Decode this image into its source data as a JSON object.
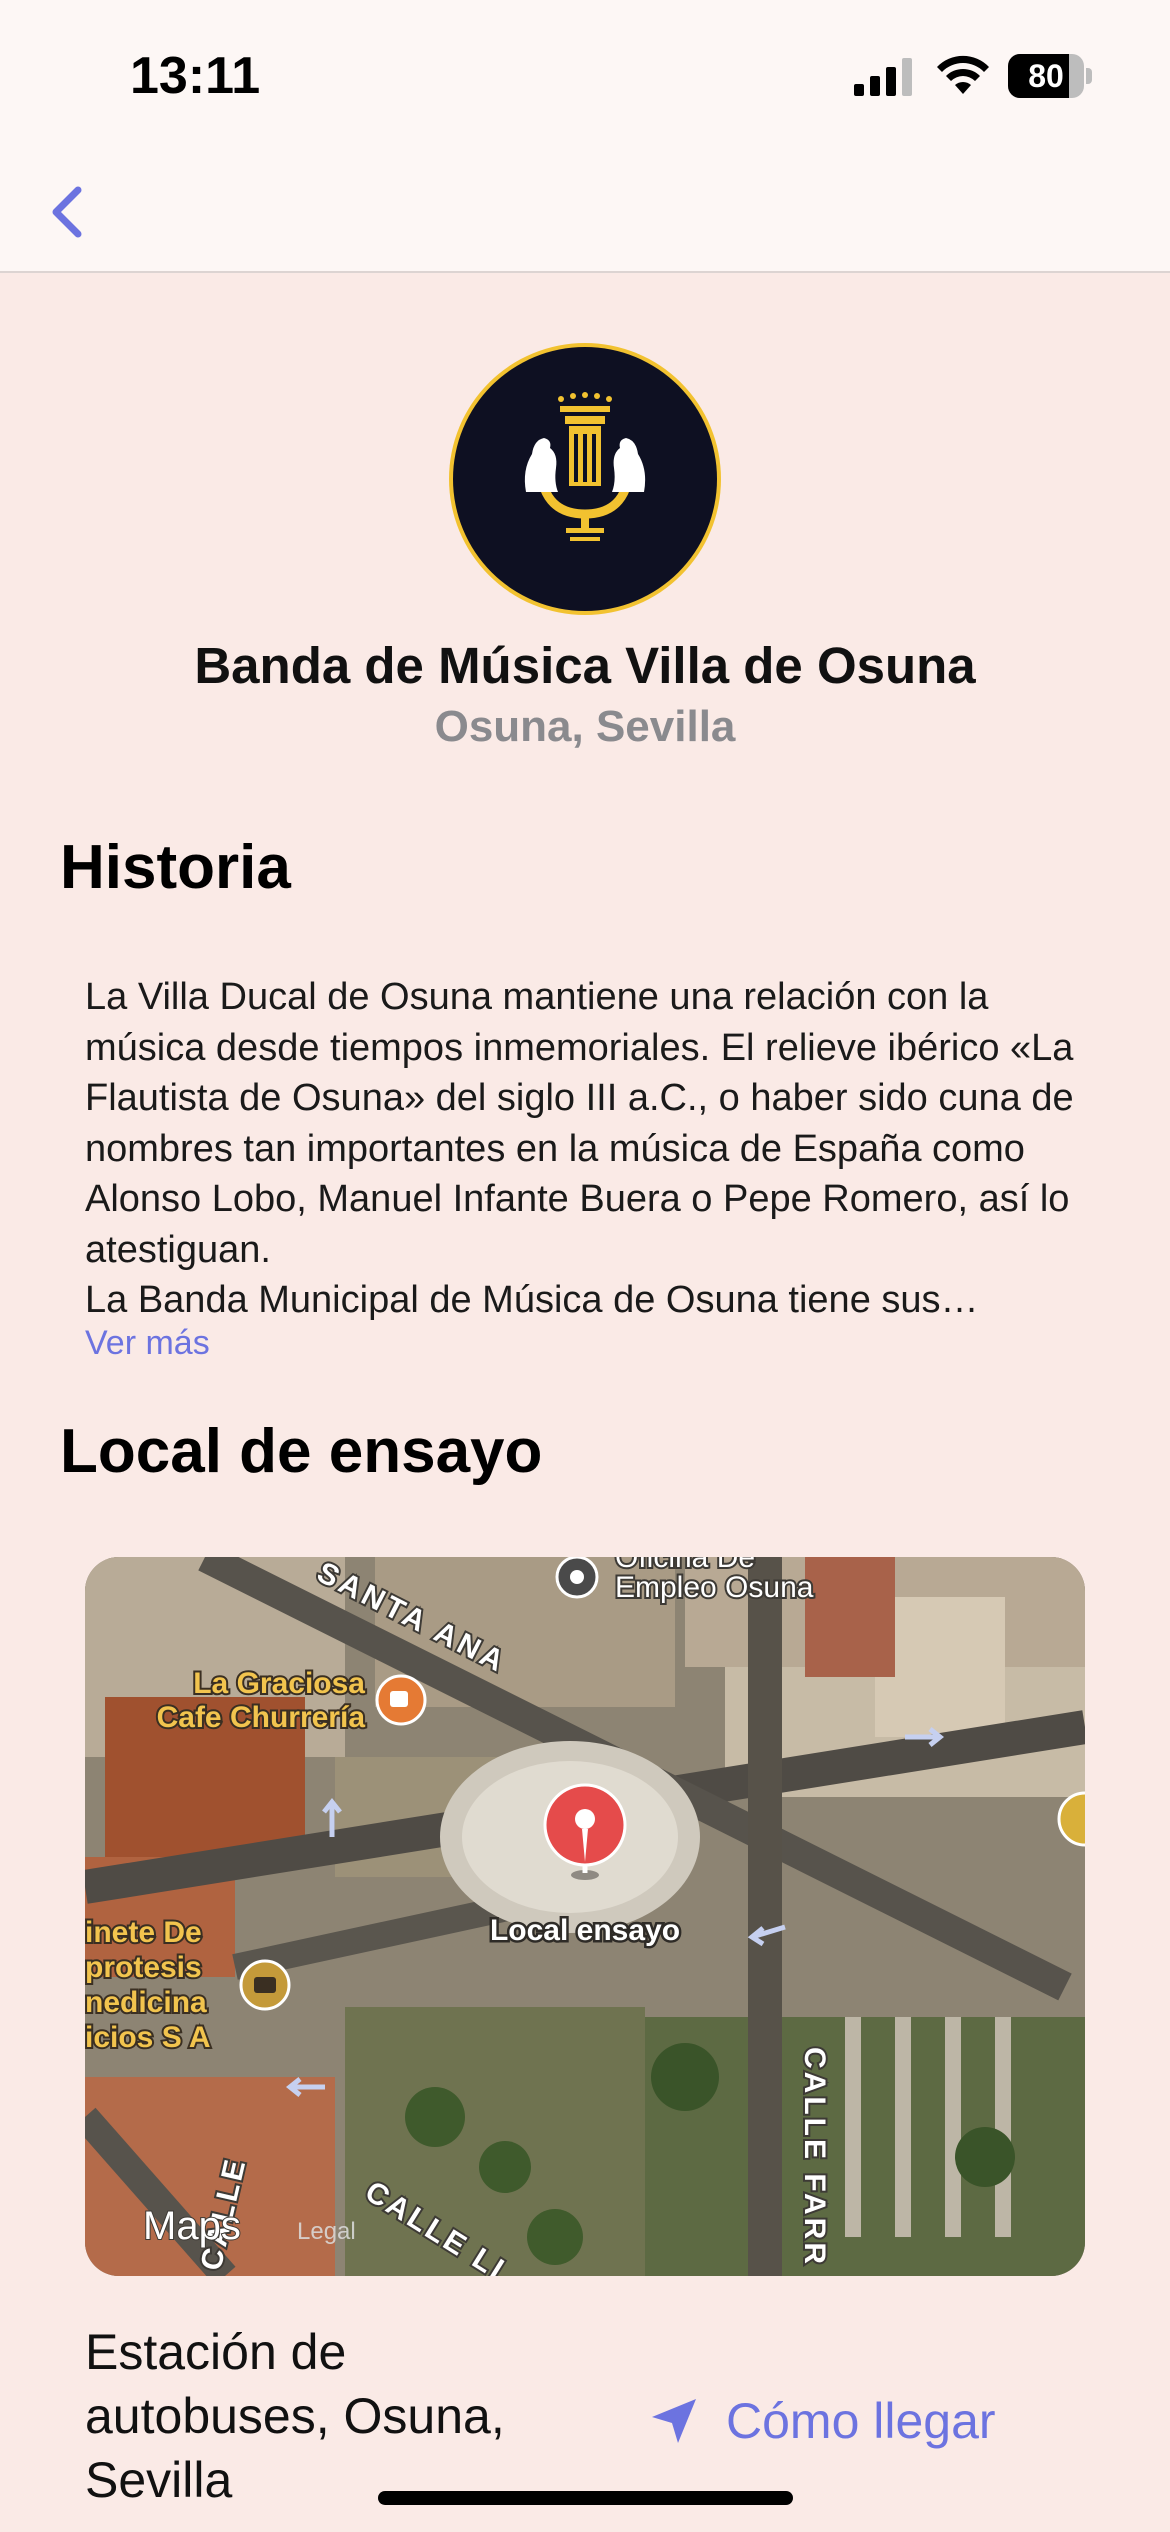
{
  "status_bar": {
    "time": "13:11",
    "battery_level": "80"
  },
  "band": {
    "name": "Banda de Música Villa de Osuna",
    "location": "Osuna, Sevilla"
  },
  "history": {
    "heading": "Historia",
    "text": "La Villa Ducal de Osuna mantiene una relación con la música desde tiempos inmemoriales. El relieve ibérico «La Flautista de Osuna» del siglo III a.C., o haber sido cuna de nombres tan importantes en la música de España como Alonso Lobo, Manuel Infante Buera o Pepe Romero, así lo atestiguan.\nLa Banda Municipal de Música de Osuna tiene sus orígenes…",
    "see_more": "Ver más"
  },
  "rehearsal": {
    "heading": "Local de ensayo",
    "map": {
      "labels": {
        "santa_ana": "SANTA ANA",
        "oficina_line1": "Oficina De",
        "oficina_line2": "Empleo Osuna",
        "cafe_line1": "La Graciosa",
        "cafe_line2": "Cafe Churrería",
        "gab_line1": "inete De",
        "gab_line2": "protesis",
        "gab_line3": "nedicina",
        "gab_line4": "icios S A",
        "pin_label": "Local ensayo",
        "calle_farr": "CALLE FARR",
        "calle_left": "CALLE",
        "calle_bottom": "CALLE LI",
        "maps_brand": "Maps",
        "legal": "Legal"
      }
    },
    "address": "Estación de autobuses, Osuna, Sevilla",
    "directions_label": "Cómo llegar"
  },
  "colors": {
    "accent": "#6c73e0",
    "background": "#faeae6",
    "logo_gold": "#f2c230",
    "logo_navy": "#0e1022"
  }
}
